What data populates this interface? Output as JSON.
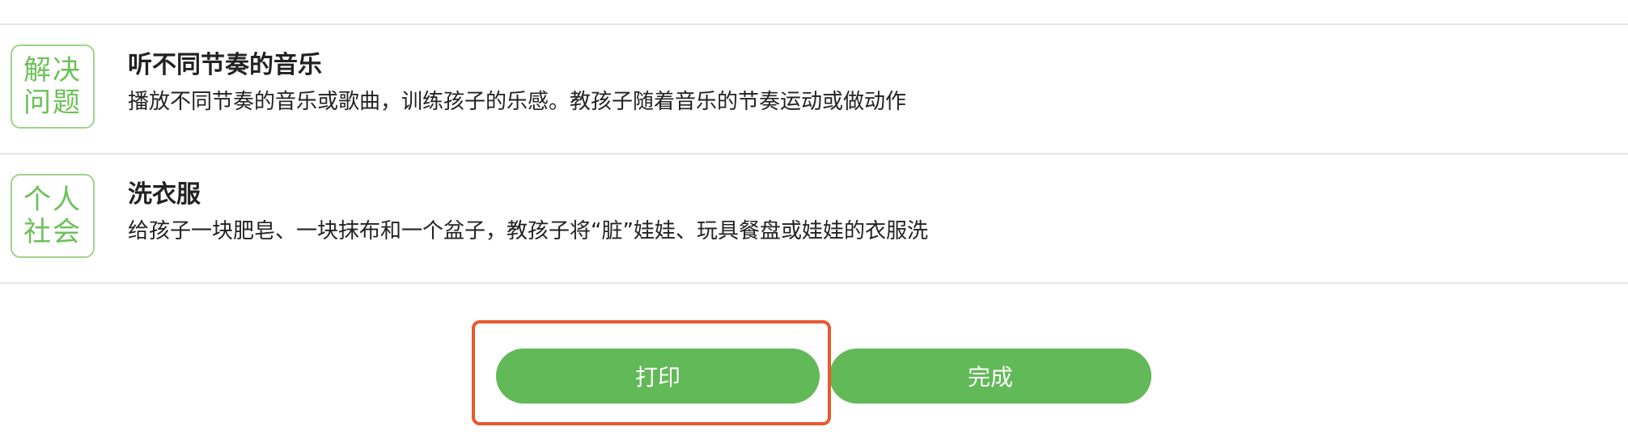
{
  "activities": [
    {
      "category": [
        "解决",
        "问题"
      ],
      "title": "听不同节奏的音乐",
      "description": "播放不同节奏的音乐或歌曲，训练孩子的乐感。教孩子随着音乐的节奏运动或做动作"
    },
    {
      "category": [
        "个人",
        "社会"
      ],
      "title": "洗衣服",
      "description": "给孩子一块肥皂、一块抹布和一个盆子，教孩子将“脏”娃娃、玩具餐盘或娃娃的衣服洗"
    }
  ],
  "buttons": {
    "print_label": "打印",
    "done_label": "完成"
  },
  "colors": {
    "accent_green": "#62b957",
    "badge_border": "#9dd48a",
    "badge_text": "#6cc158",
    "highlight": "#e8582e"
  }
}
